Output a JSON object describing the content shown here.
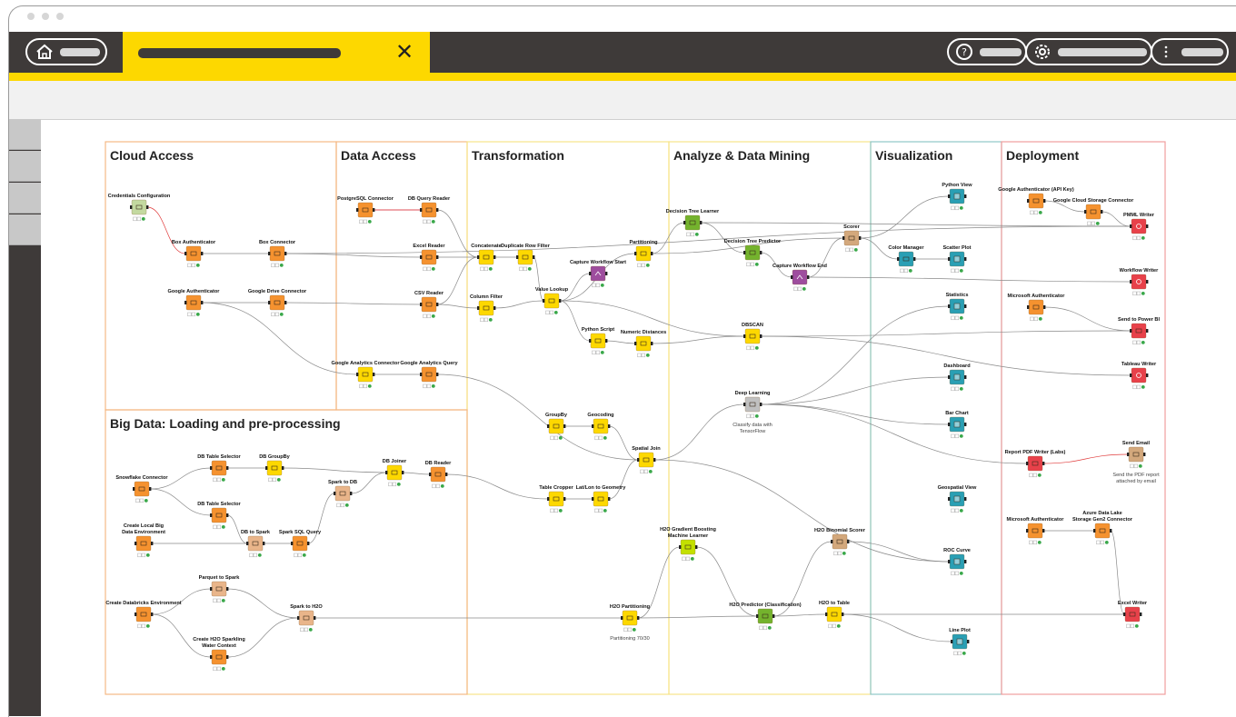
{
  "window": {
    "tab_close_glyph": "✕"
  },
  "header_icons": {
    "home": "home-icon",
    "help": "help-icon",
    "settings": "gear-icon",
    "menu": "more-vertical-icon"
  },
  "sections": [
    {
      "title": "Cloud Access",
      "color": "#f5b985"
    },
    {
      "title": "Data Access",
      "color": "#f5b985"
    },
    {
      "title": "Transformation",
      "color": "#f7e48a"
    },
    {
      "title": "Analyze & Data Mining",
      "color": "#f7e48a"
    },
    {
      "title": "Visualization",
      "color": "#8fc7c8"
    },
    {
      "title": "Deployment",
      "color": "#f19e9e"
    },
    {
      "title": "Big Data: Loading and pre-processing",
      "color": "#f5b985"
    }
  ],
  "nodes": [
    {
      "label": "Credentials Configuration",
      "color": "#c3d9a0",
      "icon": "key"
    },
    {
      "label": "Box Authenticator",
      "color": "#f5922f",
      "icon": "box"
    },
    {
      "label": "Box Connector",
      "color": "#f5922f",
      "icon": "box"
    },
    {
      "label": "Google Authenticator",
      "color": "#f5922f",
      "icon": "google"
    },
    {
      "label": "Google Drive Connector",
      "color": "#f5922f",
      "icon": "drive"
    },
    {
      "label": "PostgreSQL Connector",
      "color": "#f5922f",
      "icon": "db"
    },
    {
      "label": "DB Query Reader",
      "color": "#f5922f",
      "icon": "db"
    },
    {
      "label": "Excel Reader",
      "color": "#f5922f",
      "icon": "excel"
    },
    {
      "label": "CSV Reader",
      "color": "#f5922f",
      "icon": "csv"
    },
    {
      "label": "Google Analytics Connector",
      "color": "#fdd800",
      "icon": "analytics"
    },
    {
      "label": "Google Analytics Query",
      "color": "#f5922f",
      "icon": "analytics"
    },
    {
      "label": "Concatenate",
      "color": "#fdd800",
      "icon": "concat"
    },
    {
      "label": "Duplicate Row Filter",
      "color": "#fdd800",
      "icon": "filter"
    },
    {
      "label": "Column Filter",
      "color": "#fdd800",
      "icon": "filter"
    },
    {
      "label": "Value Lookup",
      "color": "#fdd800",
      "icon": "table"
    },
    {
      "label": "Capture Workflow Start",
      "color": "#9e4d9e",
      "icon": "capture"
    },
    {
      "label": "Partitioning",
      "color": "#fdd800",
      "icon": "table"
    },
    {
      "label": "Python Script",
      "color": "#fdd800",
      "icon": "python"
    },
    {
      "label": "Numeric Distances",
      "color": "#fdd800",
      "icon": "distance"
    },
    {
      "label": "GroupBy",
      "color": "#fdd800",
      "icon": "group"
    },
    {
      "label": "Geocoding",
      "color": "#fdd800",
      "icon": "geo"
    },
    {
      "label": "Spatial Join",
      "color": "#fdd800",
      "icon": "geo"
    },
    {
      "label": "Table Cropper",
      "color": "#fdd800",
      "icon": "crop"
    },
    {
      "label": "Lat/Lon to Geometry",
      "color": "#fdd800",
      "icon": "geo"
    },
    {
      "label": "Decision Tree Learner",
      "color": "#74b32d",
      "icon": "tree"
    },
    {
      "label": "Decision Tree Predictor",
      "color": "#74b32d",
      "icon": "tree"
    },
    {
      "label": "Capture Workflow End",
      "color": "#9e4d9e",
      "icon": "capture"
    },
    {
      "label": "Scorer",
      "color": "#d3a87c",
      "icon": "score"
    },
    {
      "label": "DBSCAN",
      "color": "#fdd800",
      "icon": "cluster"
    },
    {
      "label": "Deep Learning",
      "color": "#c0c0c0",
      "icon": "meta",
      "comment": "Classify data with TensorFlow"
    },
    {
      "label": "H2O Gradient Boosting Machine Learner",
      "color": "#c3e000",
      "icon": "h2o"
    },
    {
      "label": "H2O Partitioning",
      "color": "#fdd800",
      "icon": "h2o",
      "comment": "Partitioning 70/30"
    },
    {
      "label": "H2O Predictor (Classification)",
      "color": "#74b32d",
      "icon": "h2o"
    },
    {
      "label": "H2O Binomial Scorer",
      "color": "#d3a87c",
      "icon": "h2o"
    },
    {
      "label": "H2O to Table",
      "color": "#fdd800",
      "icon": "h2o"
    },
    {
      "label": "Python View",
      "color": "#2a9fb4",
      "icon": "view"
    },
    {
      "label": "Color Manager",
      "color": "#2a9fb4",
      "icon": "color"
    },
    {
      "label": "Scatter Plot",
      "color": "#2a9fb4",
      "icon": "view"
    },
    {
      "label": "Statistics",
      "color": "#2a9fb4",
      "icon": "view"
    },
    {
      "label": "Dashboard",
      "color": "#2a9fb4",
      "icon": "view"
    },
    {
      "label": "Bar Chart",
      "color": "#2a9fb4",
      "icon": "view"
    },
    {
      "label": "Geospatial View",
      "color": "#2a9fb4",
      "icon": "view"
    },
    {
      "label": "ROC Curve",
      "color": "#2a9fb4",
      "icon": "view"
    },
    {
      "label": "Line Plot",
      "color": "#2a9fb4",
      "icon": "view"
    },
    {
      "label": "Google Authenticator (API Key)",
      "color": "#f5922f",
      "icon": "google"
    },
    {
      "label": "Google Cloud Storage Connector",
      "color": "#f5922f",
      "icon": "cloud"
    },
    {
      "label": "PMML Writer",
      "color": "#e8414a",
      "icon": "writer"
    },
    {
      "label": "Workflow Writer",
      "color": "#e8414a",
      "icon": "writer"
    },
    {
      "label": "Microsoft Authenticator",
      "color": "#f5922f",
      "icon": "ms"
    },
    {
      "label": "Send to Power BI",
      "color": "#e8414a",
      "icon": "powerbi"
    },
    {
      "label": "Tableau Writer",
      "color": "#e8414a",
      "icon": "writer"
    },
    {
      "label": "Report PDF Writer (Labs)",
      "color": "#e8414a",
      "icon": "pdf"
    },
    {
      "label": "Send Email",
      "color": "#d3a87c",
      "icon": "mail",
      "comment": "Send the PDF report attached by email"
    },
    {
      "label": "Microsoft Authenticator",
      "color": "#f5922f",
      "icon": "ms"
    },
    {
      "label": "Azure Data Lake Storage Gen2 Connector",
      "color": "#f5922f",
      "icon": "cloud"
    },
    {
      "label": "Excel Writer",
      "color": "#e8414a",
      "icon": "excel"
    },
    {
      "label": "Snowflake Connector",
      "color": "#f5922f",
      "icon": "db"
    },
    {
      "label": "DB Table Selector",
      "color": "#f5922f",
      "icon": "db"
    },
    {
      "label": "DB GroupBy",
      "color": "#fdd800",
      "icon": "db"
    },
    {
      "label": "DB Table Selector",
      "color": "#f5922f",
      "icon": "db"
    },
    {
      "label": "DB Joiner",
      "color": "#fdd800",
      "icon": "db"
    },
    {
      "label": "DB Reader",
      "color": "#f5922f",
      "icon": "db"
    },
    {
      "label": "Spark to DB",
      "color": "#e9b58a",
      "icon": "spark"
    },
    {
      "label": "Create Local Big Data Environment",
      "color": "#f5922f",
      "icon": "bigdata"
    },
    {
      "label": "DB to Spark",
      "color": "#e9b58a",
      "icon": "spark"
    },
    {
      "label": "Spark SQL Query",
      "color": "#f5922f",
      "icon": "spark"
    },
    {
      "label": "Create Databricks Environment",
      "color": "#f5922f",
      "icon": "bigdata"
    },
    {
      "label": "Parquet to Spark",
      "color": "#e9b58a",
      "icon": "spark"
    },
    {
      "label": "Create H2O Sparkling Water Context",
      "color": "#f5922f",
      "icon": "h2o"
    },
    {
      "label": "Spark to H2O",
      "color": "#e9b58a",
      "icon": "spark"
    }
  ]
}
